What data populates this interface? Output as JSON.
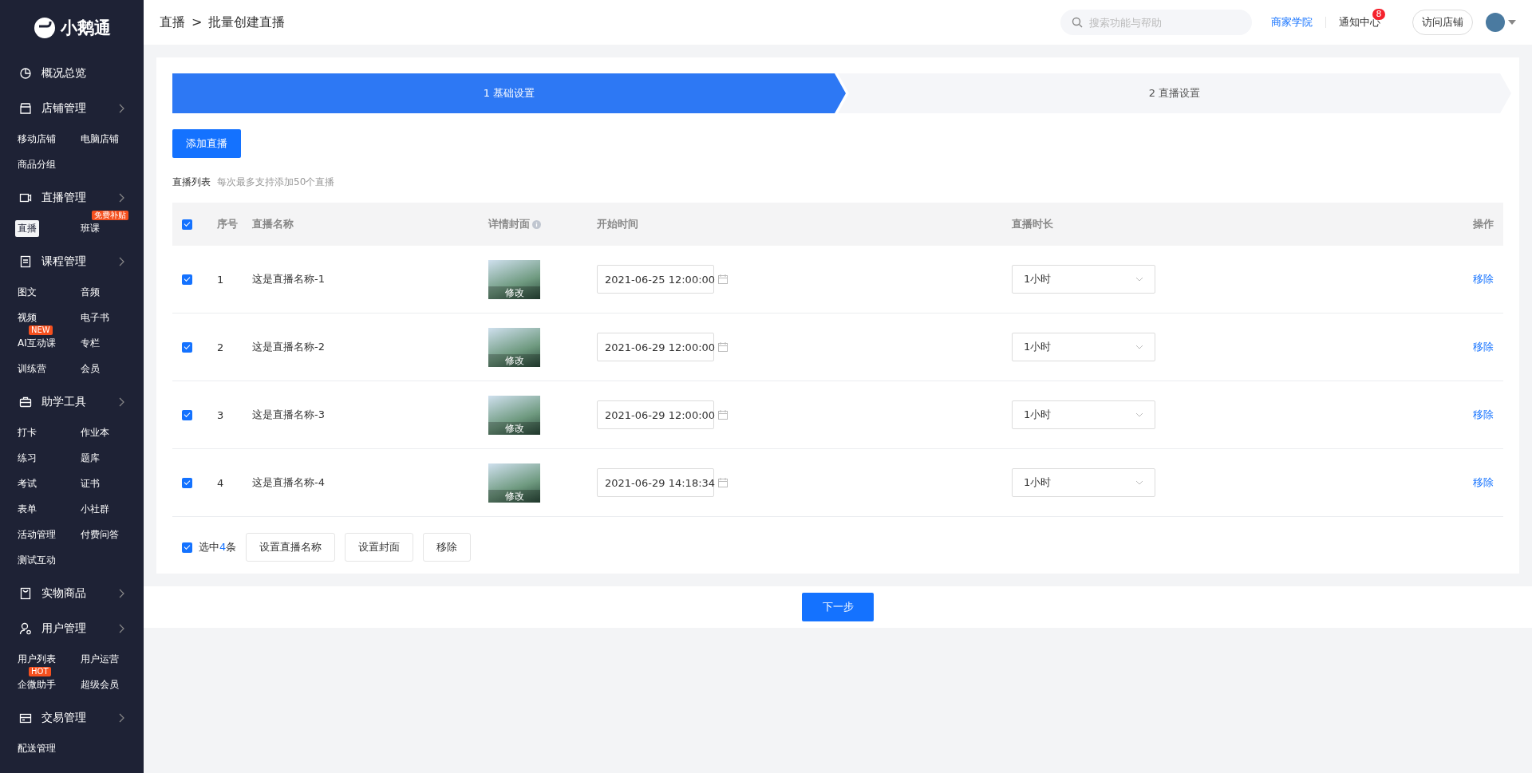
{
  "sidebar": {
    "logo": "小鹅通",
    "groups": [
      {
        "kind": "overview",
        "title": "概况总览",
        "expandable": false
      },
      {
        "kind": "shop",
        "title": "店铺管理",
        "expandable": true,
        "items": [
          {
            "label": "移动店铺",
            "selected": false
          },
          {
            "label": "电脑店铺",
            "selected": false
          },
          {
            "label": "商品分组",
            "selected": false
          }
        ]
      },
      {
        "kind": "live",
        "title": "直播管理",
        "expandable": true,
        "items": [
          {
            "label": "直播",
            "selected": true
          },
          {
            "label": "班课",
            "selected": false,
            "badge": "免费补贴"
          }
        ]
      },
      {
        "kind": "course",
        "title": "课程管理",
        "expandable": true,
        "items": [
          {
            "label": "图文",
            "selected": false
          },
          {
            "label": "音频",
            "selected": false
          },
          {
            "label": "视频",
            "selected": false
          },
          {
            "label": "电子书",
            "selected": false
          },
          {
            "label": "AI互动课",
            "selected": false,
            "badge": "NEW"
          },
          {
            "label": "专栏",
            "selected": false
          },
          {
            "label": "训练营",
            "selected": false
          },
          {
            "label": "会员",
            "selected": false
          }
        ]
      },
      {
        "kind": "tools",
        "title": "助学工具",
        "expandable": true,
        "items": [
          {
            "label": "打卡",
            "selected": false
          },
          {
            "label": "作业本",
            "selected": false
          },
          {
            "label": "练习",
            "selected": false
          },
          {
            "label": "题库",
            "selected": false
          },
          {
            "label": "考试",
            "selected": false
          },
          {
            "label": "证书",
            "selected": false
          },
          {
            "label": "表单",
            "selected": false
          },
          {
            "label": "小社群",
            "selected": false
          },
          {
            "label": "活动管理",
            "selected": false
          },
          {
            "label": "付费问答",
            "selected": false
          },
          {
            "label": "测试互动",
            "selected": false
          }
        ]
      },
      {
        "kind": "goods",
        "title": "实物商品",
        "expandable": true
      },
      {
        "kind": "user",
        "title": "用户管理",
        "expandable": true,
        "items": [
          {
            "label": "用户列表",
            "selected": false
          },
          {
            "label": "用户运营",
            "selected": false
          },
          {
            "label": "企微助手",
            "selected": false,
            "badge": "HOT"
          },
          {
            "label": "超级会员",
            "selected": false
          }
        ]
      },
      {
        "kind": "trade",
        "title": "交易管理",
        "expandable": true,
        "items": [
          {
            "label": "配送管理",
            "selected": false
          }
        ]
      }
    ]
  },
  "header": {
    "breadcrumb": [
      "直播",
      "批量创建直播"
    ],
    "separator": ">",
    "search": {
      "placeholder": "搜索功能与帮助"
    },
    "academy_link": "商家学院",
    "notifications": {
      "label": "通知中心",
      "count": "8"
    },
    "visit_button": "访问店铺"
  },
  "steps": [
    {
      "label": "1 基础设置",
      "selected": true
    },
    {
      "label": "2 直播设置",
      "selected": false
    }
  ],
  "add_button": "添加直播",
  "list_title": "直播列表",
  "list_hint": "每次最多支持添加50个直播",
  "table": {
    "all_checked": true,
    "columns": [
      "序号",
      "直播名称",
      "详情封面",
      "开始时间",
      "直播时长",
      "操作"
    ],
    "rows": [
      {
        "checked": true,
        "index": "1",
        "name": "这是直播名称-1",
        "cover_action": "修改",
        "start_time": "2021-06-25 12:00:00",
        "duration": "1小时",
        "action": "移除"
      },
      {
        "checked": true,
        "index": "2",
        "name": "这是直播名称-2",
        "cover_action": "修改",
        "start_time": "2021-06-29 12:00:00",
        "duration": "1小时",
        "action": "移除"
      },
      {
        "checked": true,
        "index": "3",
        "name": "这是直播名称-3",
        "cover_action": "修改",
        "start_time": "2021-06-29 12:00:00",
        "duration": "1小时",
        "action": "移除"
      },
      {
        "checked": true,
        "index": "4",
        "name": "这是直播名称-4",
        "cover_action": "修改",
        "start_time": "2021-06-29 14:18:34",
        "duration": "1小时",
        "action": "移除"
      }
    ]
  },
  "batch": {
    "checked": true,
    "selected_prefix": "选中",
    "selected_count": "4",
    "selected_suffix": "条",
    "buttons": [
      "设置直播名称",
      "设置封面",
      "移除"
    ]
  },
  "next_button": "下一步"
}
